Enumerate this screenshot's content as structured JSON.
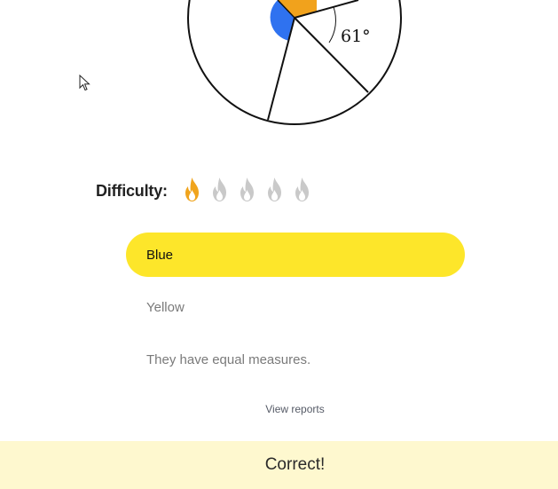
{
  "figure": {
    "angle_label": "61°",
    "sector_colors": {
      "blue": "#2f72f0",
      "orange": "#f1a21c"
    }
  },
  "difficulty": {
    "label": "Difficulty:",
    "level": 1,
    "max": 5,
    "active_color": "#f0a41d",
    "inactive_color": "#c9c9c9"
  },
  "choices": [
    {
      "label": "Blue",
      "selected": true
    },
    {
      "label": "Yellow",
      "selected": false
    },
    {
      "label": "They have equal measures.",
      "selected": false
    }
  ],
  "links": {
    "view_reports": "View reports"
  },
  "feedback": {
    "message": "Correct!"
  },
  "colors": {
    "selected_choice": "#fde62a",
    "banner": "#fef8cf"
  }
}
